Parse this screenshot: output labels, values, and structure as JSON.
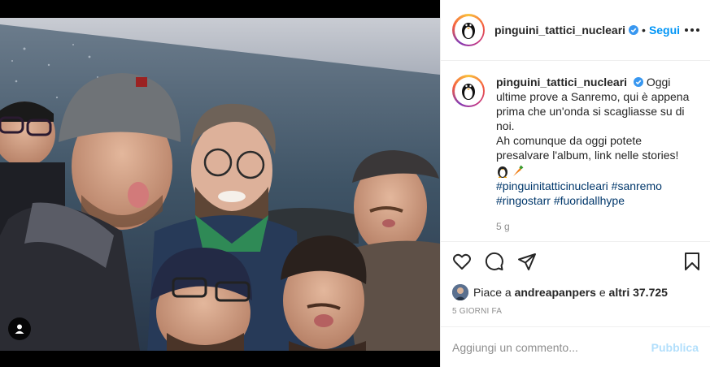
{
  "post": {
    "username": "pinguini_tattici_nucleari",
    "separator": "•",
    "follow_label": "Segui",
    "caption": {
      "line1": "Oggi ultime prove a Sanremo, qui è appena prima che un'onda si scagliasse su di noi.",
      "line2": "Ah comunque da oggi potete presalvare l'album, link nelle stories!",
      "emojis": [
        "penguin-emoji",
        "carrot-emoji"
      ],
      "hashtags": [
        "#pinguinitatticinucleari",
        "#sanremo",
        "#ringostarr",
        "#fuoridallhype"
      ]
    },
    "relative_time": "5 g",
    "likes": {
      "prefix": "Piace a",
      "user": "andreapanpers",
      "conjunction": "e",
      "others": "altri 37.725"
    },
    "date": "5 GIORNI FA"
  },
  "comment_box": {
    "placeholder": "Aggiungi un commento...",
    "publish_label": "Pubblica"
  },
  "icons": {
    "verified": "verified-badge-icon",
    "like": "heart-icon",
    "comment": "comment-icon",
    "share": "paper-plane-icon",
    "save": "bookmark-icon",
    "more": "more-options-icon",
    "tag": "user-tag-icon"
  },
  "colors": {
    "accent": "#0095f6",
    "verified": "#3897f0",
    "hashtag": "#00376b",
    "muted": "#8e8e8e",
    "publish_disabled": "#b2dffc"
  }
}
